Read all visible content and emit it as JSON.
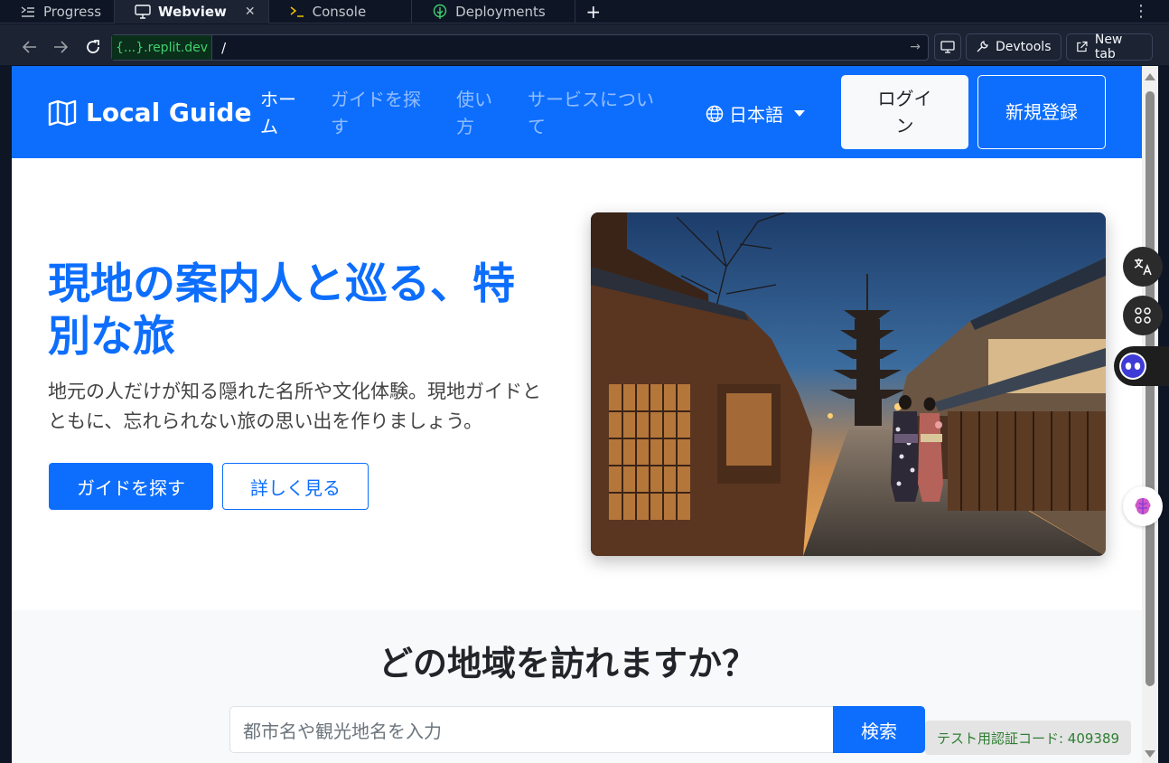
{
  "ide": {
    "tabs": [
      {
        "label": "Progress",
        "icon": "progress-icon"
      },
      {
        "label": "Webview",
        "icon": "monitor-icon"
      },
      {
        "label": "Console",
        "icon": "terminal-icon"
      },
      {
        "label": "Deployments",
        "icon": "deploy-icon"
      }
    ],
    "url_chip": "{...}.replit.dev",
    "url_path": "/",
    "devtools_label": "Devtools",
    "new_tab_label": "New tab"
  },
  "site": {
    "brand": "Local Guide",
    "nav": [
      {
        "label": "ホーム",
        "active": true
      },
      {
        "label": "ガイドを探す",
        "active": false
      },
      {
        "label": "使い方",
        "active": false
      },
      {
        "label": "サービスについて",
        "active": false
      }
    ],
    "language": "日本語",
    "login": "ログイン",
    "signup": "新規登録"
  },
  "hero": {
    "title": "現地の案内人と巡る、特別な旅",
    "subtitle": "地元の人だけが知る隠れた名所や文化体験。現地ガイドとともに、忘れられない旅の思い出を作りましょう。",
    "primary_button": "ガイドを探す",
    "secondary_button": "詳しく見る"
  },
  "region": {
    "title": "どの地域を訪れますか？",
    "search_placeholder": "都市名や観光地名を入力",
    "search_button": "検索",
    "test_code": "テスト用認証コード: 409389"
  },
  "colors": {
    "primary": "#0d6efd",
    "ide_bg": "#0e1525"
  }
}
